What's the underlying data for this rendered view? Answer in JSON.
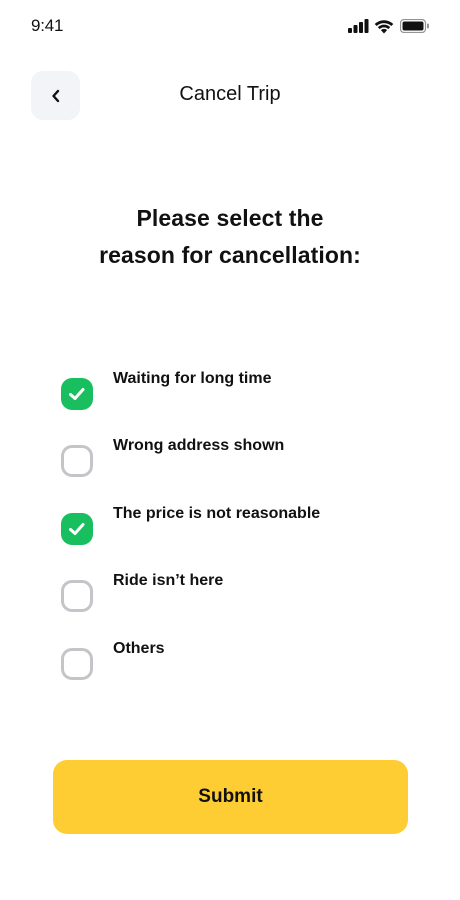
{
  "status_bar": {
    "time": "9:41",
    "icons": [
      "cellular-signal-icon",
      "wifi-icon",
      "battery-icon"
    ]
  },
  "header": {
    "back_icon": "chevron-left-icon",
    "title": "Cancel Trip"
  },
  "question": {
    "line1": "Please select the",
    "line2": "reason for cancellation:"
  },
  "options": [
    {
      "label": "Waiting for long time",
      "checked": true
    },
    {
      "label": "Wrong address shown",
      "checked": false
    },
    {
      "label": "The price is not reasonable",
      "checked": true
    },
    {
      "label": "Ride isn’t here",
      "checked": false
    },
    {
      "label": "Others",
      "checked": false
    }
  ],
  "submit": {
    "label": "Submit"
  },
  "colors": {
    "accent_yellow": "#fdcd33",
    "check_green": "#19bf5f",
    "unchecked_border": "#c4c5c9",
    "back_button_bg": "#f3f4f7"
  }
}
